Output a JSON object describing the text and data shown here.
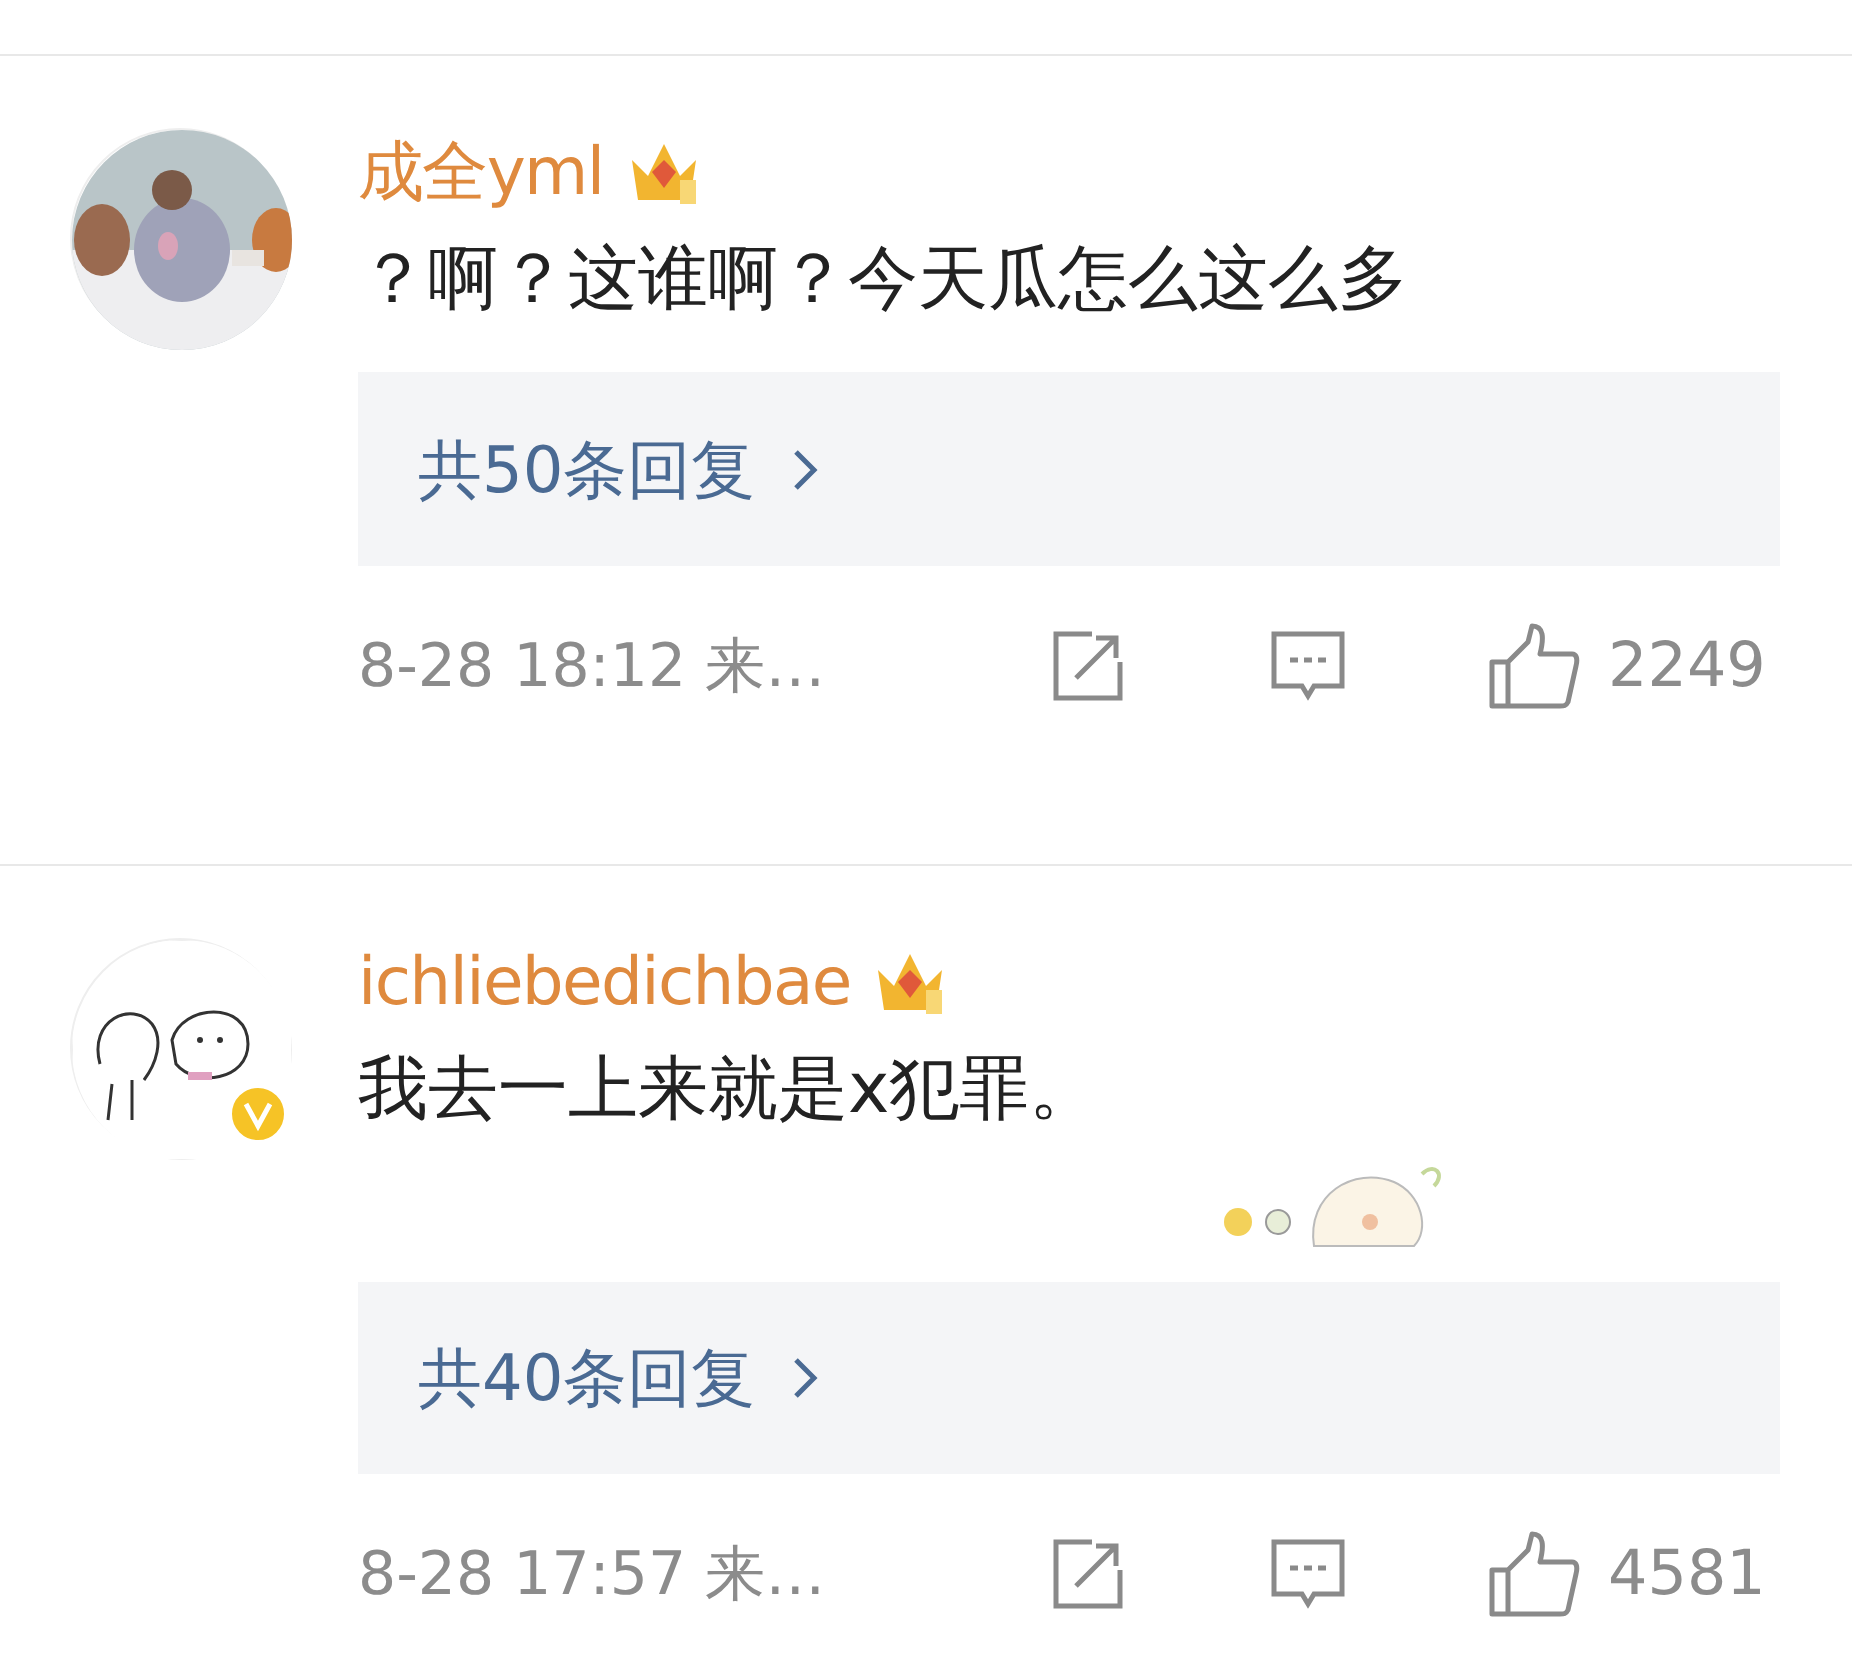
{
  "comments": [
    {
      "username": "成全yml",
      "text": "？啊？这谁啊？今天瓜怎么这么多",
      "sticker": false,
      "replies": "共50条回复",
      "time": "8-28 18:12 来…",
      "likes": "2249"
    },
    {
      "username": "ichliebedichbae",
      "avatar": {
        "kind": "drawing",
        "verified": true
      },
      "text": "我去一上来就是x犯罪。",
      "sticker": true,
      "replies": "共40条回复",
      "time": "8-28 17:57 来…",
      "likes": "4581"
    }
  ]
}
